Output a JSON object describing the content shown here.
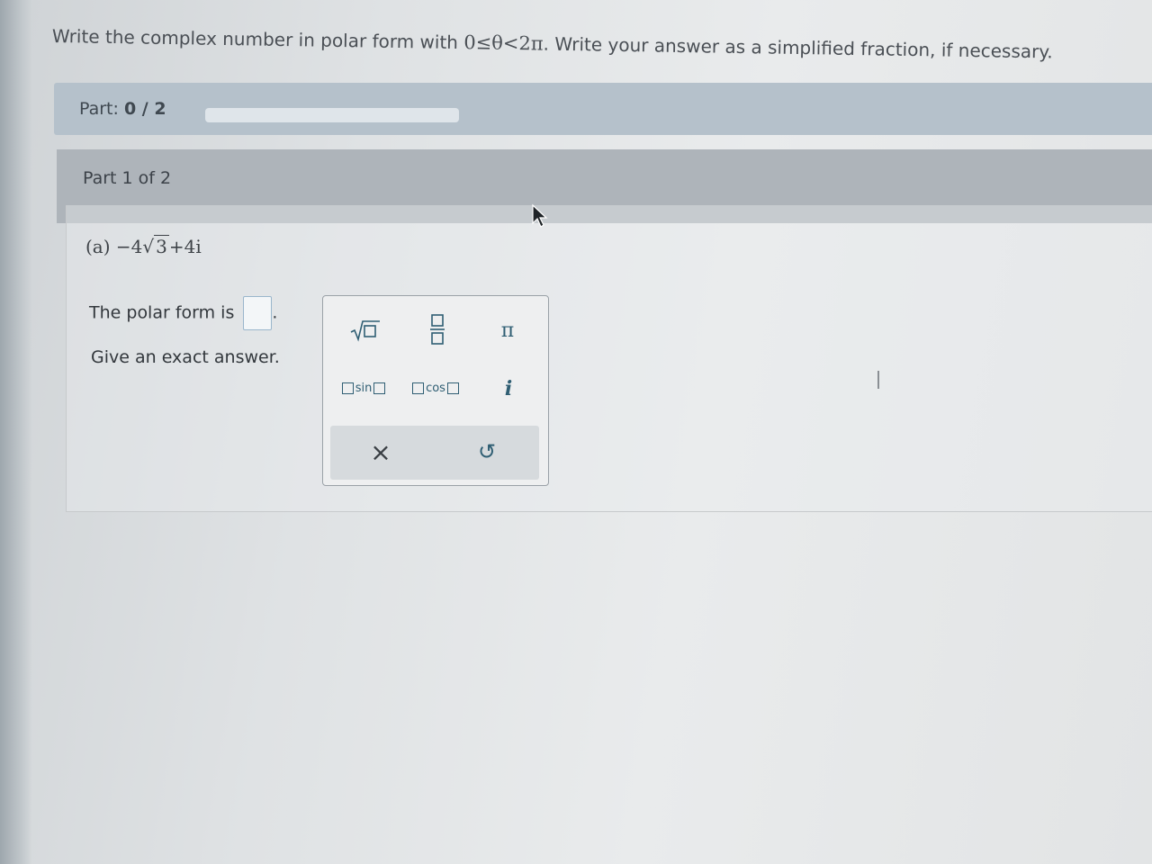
{
  "prompt": {
    "text_before": "Write the complex number in polar form with ",
    "math": "0≤θ<2π",
    "text_after": ". Write your answer as a simplified fraction, if necessary."
  },
  "progress": {
    "label": "Part:",
    "value": "0 / 2",
    "fraction": 0.0
  },
  "part": {
    "title": "Part 1 of 2"
  },
  "question": {
    "label": "(a)",
    "prefix": "−4",
    "radicand": "3",
    "suffix": "+4i"
  },
  "answer": {
    "prefix": "The polar form is",
    "suffix": "."
  },
  "hint": "Give an exact answer.",
  "keypad": {
    "pi": "π",
    "i": "i",
    "sin": "sin",
    "cos": "cos",
    "clear": "×",
    "undo": "↺"
  }
}
